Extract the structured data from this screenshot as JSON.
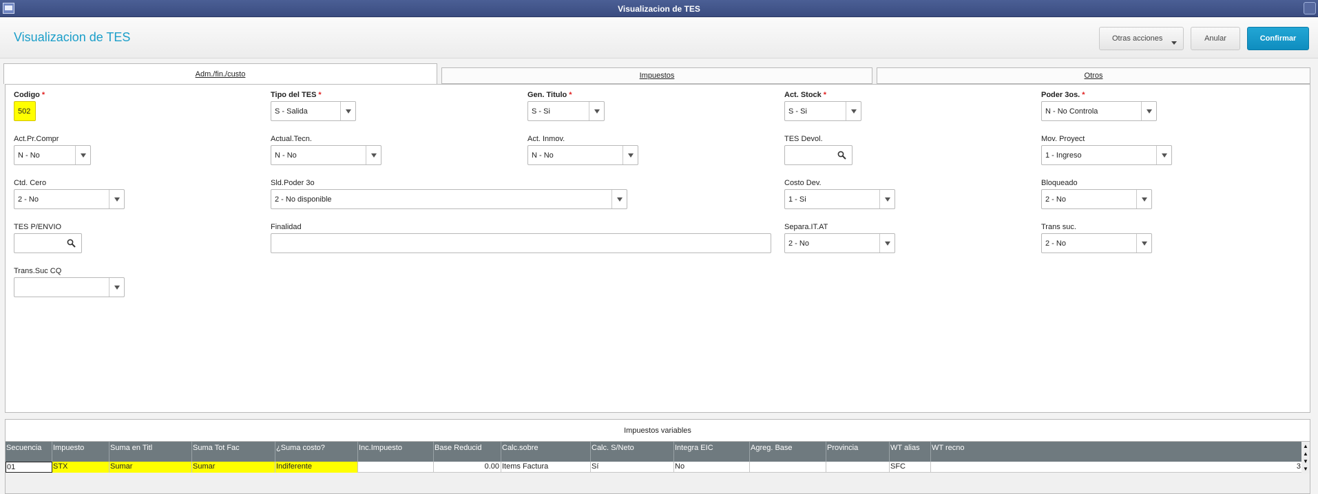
{
  "window": {
    "title": "Visualizacion de TES"
  },
  "header": {
    "title": "Visualizacion de TES"
  },
  "toolbar": {
    "other_actions": "Otras acciones",
    "cancel": "Anular",
    "confirm": "Confirmar"
  },
  "tabs": [
    {
      "label": "Adm./fin./custo",
      "active": true
    },
    {
      "label": "Impuestos",
      "active": false
    },
    {
      "label": "Otros",
      "active": false
    }
  ],
  "fields": {
    "codigo": {
      "label": "Codigo",
      "value": "502",
      "required": "*"
    },
    "tipo_tes": {
      "label": "Tipo del TES",
      "value": "S - Salida",
      "required": "*"
    },
    "gen_titulo": {
      "label": "Gen. Titulo",
      "value": "S - Si",
      "required": "*"
    },
    "act_stock": {
      "label": "Act. Stock",
      "value": "S - Si",
      "required": "*"
    },
    "poder_3os": {
      "label": "Poder 3os.",
      "value": "N - No Controla",
      "required": "*"
    },
    "act_pr_compr": {
      "label": "Act.Pr.Compr",
      "value": "N - No"
    },
    "actual_tecn": {
      "label": "Actual.Tecn.",
      "value": "N - No"
    },
    "act_inmov": {
      "label": "Act. Inmov.",
      "value": "N - No"
    },
    "tes_devol": {
      "label": "TES Devol.",
      "value": ""
    },
    "mov_proyect": {
      "label": "Mov. Proyect",
      "value": "1 - Ingreso"
    },
    "ctd_cero": {
      "label": "Ctd. Cero",
      "value": "2 - No"
    },
    "sld_poder_3o": {
      "label": "Sld.Poder 3o",
      "value": "2 - No disponible"
    },
    "costo_dev": {
      "label": "Costo Dev.",
      "value": "1 - Si"
    },
    "bloqueado": {
      "label": "Bloqueado",
      "value": "2 - No"
    },
    "tes_penvio": {
      "label": "TES P/ENVIO",
      "value": ""
    },
    "finalidad": {
      "label": "Finalidad",
      "value": ""
    },
    "separa_it_at": {
      "label": "Separa.IT.AT",
      "value": "2 - No"
    },
    "trans_suc": {
      "label": "Trans suc.",
      "value": "2 - No"
    },
    "trans_suc_cq": {
      "label": "Trans.Suc CQ",
      "value": ""
    }
  },
  "grid": {
    "title": "Impuestos variables",
    "columns": [
      "Secuencia",
      "Impuesto",
      "Suma en Titl",
      "Suma Tot Fac",
      "¿Suma costo?",
      "Inc.Impuesto",
      "Base Reducid",
      "Calc.sobre",
      "Calc. S/Neto",
      "Integra EIC",
      "Agreg. Base",
      "Provincia",
      "WT alias",
      "WT recno"
    ],
    "rows": [
      [
        "01",
        "STX",
        "Sumar",
        "Sumar",
        "Indiferente",
        "",
        "0.00",
        "Items Factura",
        "Sí",
        "No",
        "",
        "",
        "SFC",
        "3"
      ]
    ]
  },
  "icons": {
    "app": "window-icon",
    "search": "magnifier-icon",
    "dropdown": "caret-down-icon"
  },
  "colors": {
    "accent": "#1a9ec9",
    "confirm": "#1595c6",
    "highlight": "#ffff00",
    "required": "#e02020",
    "grid_header": "#6f7a7f"
  }
}
